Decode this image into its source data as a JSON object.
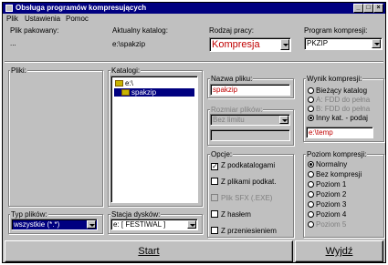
{
  "window": {
    "title": "Obsługa programów kompresujących",
    "min_label": "_",
    "max_label": "□",
    "close_label": "×"
  },
  "menu": [
    {
      "label": "Plik"
    },
    {
      "label": "Ustawienia"
    },
    {
      "label": "Pomoc"
    }
  ],
  "plik_pakowany": {
    "label": "Plik pakowany:",
    "value": "..."
  },
  "aktualny_katalog": {
    "label": "Aktualny katalog:",
    "value": "e:\\spakzip"
  },
  "rodzaj_pracy": {
    "label": "Rodzaj pracy:",
    "value": "Kompresja"
  },
  "program_kompresji": {
    "label": "Program kompresji:",
    "value": "PKZIP"
  },
  "pliki": {
    "label": "Pliki:"
  },
  "katalogi": {
    "label": "Katalogi:",
    "items": [
      "e:\\",
      "spakzip"
    ]
  },
  "nazwa_pliku": {
    "label": "Nazwa pliku:",
    "value": "spakzip"
  },
  "rozmiar": {
    "label": "Rozmiar plików:",
    "value": "Bez limitu"
  },
  "wynik": {
    "label": "Wynik kompresji:",
    "options": [
      {
        "label": "Bieżący katalog",
        "selected": false,
        "enabled": true
      },
      {
        "label": "A: FDD do pełna",
        "selected": false,
        "enabled": false
      },
      {
        "label": "B: FDD do pełna",
        "selected": false,
        "enabled": false
      },
      {
        "label": "Inny kat. - podaj",
        "selected": true,
        "enabled": true
      }
    ],
    "path": "e:\\temp"
  },
  "opcje": {
    "label": "Opcje:",
    "items": [
      {
        "label": "Z podkatalogami",
        "checked": true,
        "enabled": true
      },
      {
        "label": "Z plikami podkat.",
        "checked": false,
        "enabled": true
      },
      {
        "label": "Plik SFX (.EXE)",
        "checked": false,
        "enabled": false
      },
      {
        "label": "Z hasłem",
        "checked": false,
        "enabled": true
      },
      {
        "label": "Z przeniesieniem",
        "checked": false,
        "enabled": true
      }
    ]
  },
  "poziom": {
    "label": "Poziom kompresji:",
    "options": [
      {
        "label": "Normalny",
        "selected": true,
        "enabled": true
      },
      {
        "label": "Bez kompresji",
        "selected": false,
        "enabled": true
      },
      {
        "label": "Poziom 1",
        "selected": false,
        "enabled": true
      },
      {
        "label": "Poziom 2",
        "selected": false,
        "enabled": true
      },
      {
        "label": "Poziom 3",
        "selected": false,
        "enabled": true
      },
      {
        "label": "Poziom 4",
        "selected": false,
        "enabled": true
      },
      {
        "label": "Poziom 5",
        "selected": false,
        "enabled": false
      }
    ]
  },
  "typ_plikow": {
    "label": "Typ plików:",
    "value": "wszystkie (*.*)"
  },
  "stacja_dyskow": {
    "label": "Stacja dysków:",
    "value": "e: [ FESTIWAL ]"
  },
  "buttons": {
    "start": "Start",
    "wyjdz": "Wyjdź"
  }
}
